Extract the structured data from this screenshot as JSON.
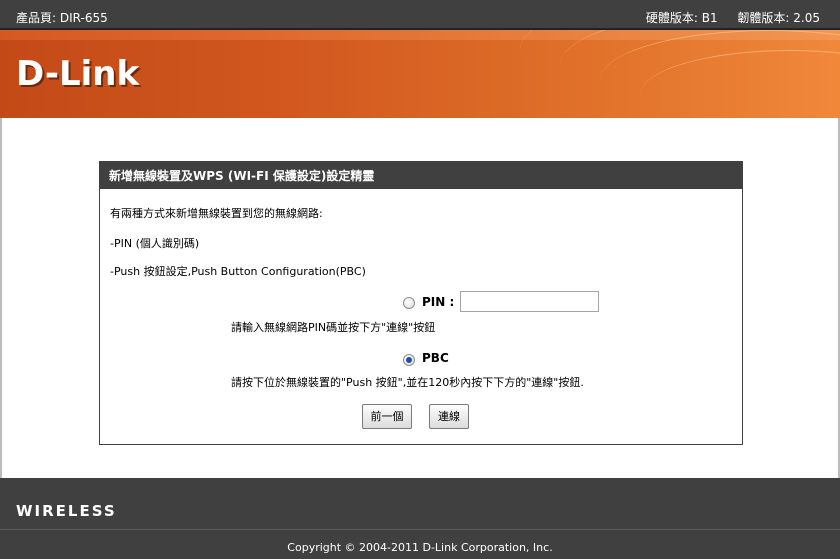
{
  "header": {
    "product_page": "產品頁: DIR-655",
    "hardware_version": "硬體版本: B1",
    "firmware_version": "韌體版本: 2.05"
  },
  "brand": {
    "logo_text": "D-Link"
  },
  "panel": {
    "title": "新增無線裝置及WPS (WI-FI 保護設定)設定精靈",
    "intro": "有兩種方式來新增無線裝置到您的無線網路:",
    "option1": "-PIN (個人識別碼)",
    "option2": "-Push 按鈕設定,Push Button Configuration(PBC)",
    "pin_label": "PIN :",
    "pin_hint": "請輸入無線網路PIN碼並按下方\"連線\"按鈕",
    "pbc_label": "PBC",
    "pbc_hint": "請按下位於無線裝置的\"Push 按鈕\",並在120秒內按下下方的\"連線\"按鈕.",
    "pin_value": "",
    "selected_method": "PBC",
    "prev_button": "前一個",
    "connect_button": "連線"
  },
  "footer": {
    "wireless_label": "WIRELESS",
    "copyright": "Copyright © 2004-2011 D-Link Corporation, Inc."
  },
  "colors": {
    "bar_gray": "#404040",
    "banner_orange": "#d2581f",
    "radio_checked": "#1e4ea8"
  }
}
